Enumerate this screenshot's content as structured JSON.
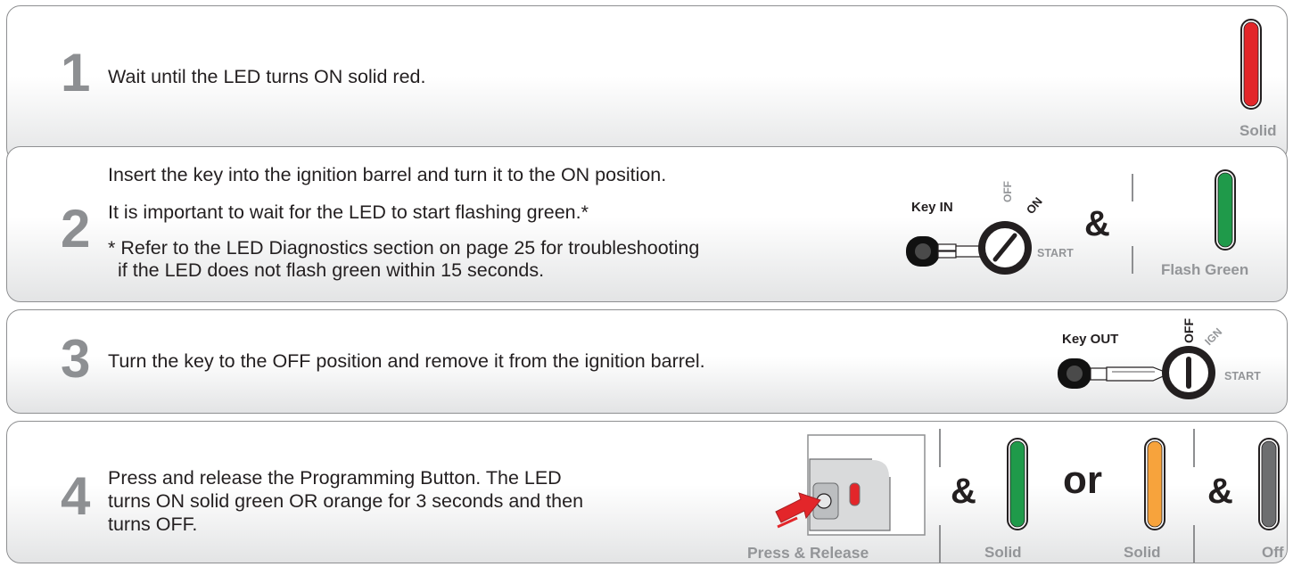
{
  "steps": [
    {
      "number": "1",
      "lines": [
        "Wait until the LED turns ON solid red."
      ],
      "led": {
        "color": "#e3262a",
        "caption": "Solid"
      }
    },
    {
      "number": "2",
      "lines": [
        "Insert the key into the ignition barrel and turn it to the ON position.",
        "It is important to wait for the LED to start flashing green.*",
        "* Refer to the LED Diagnostics section on page 25 for troubleshooting",
        "if the LED does not flash green within 15 seconds."
      ],
      "key_label": "Key IN",
      "ignition_labels": {
        "off": "OFF",
        "on": "ON",
        "start": "START"
      },
      "connector": "&",
      "led": {
        "color": "#1f9a4a",
        "caption": "Flash Green"
      }
    },
    {
      "number": "3",
      "lines": [
        "Turn the key to the OFF position and remove it from the ignition barrel."
      ],
      "key_label": "Key OUT",
      "ignition_labels": {
        "off": "OFF",
        "ign": "IGN",
        "start": "START"
      }
    },
    {
      "number": "4",
      "lines": [
        "Press and release the Programming Button. The LED",
        "turns ON solid green OR orange for 3 seconds and then",
        "turns OFF."
      ],
      "button_caption": "Press & Release",
      "connector_1": "&",
      "led_green": {
        "color": "#1f9a4a",
        "caption": "Solid"
      },
      "connector_or": "or",
      "led_orange": {
        "color": "#f7a33c",
        "caption": "Solid"
      },
      "connector_2": "&",
      "led_off": {
        "color": "#6d6e70",
        "caption": "Off"
      }
    }
  ],
  "icons": {
    "led": "led-indicator-icon",
    "key": "car-key-icon",
    "ignition": "ignition-barrel-icon",
    "module": "remote-start-module-icon",
    "arrow": "press-arrow-icon"
  }
}
